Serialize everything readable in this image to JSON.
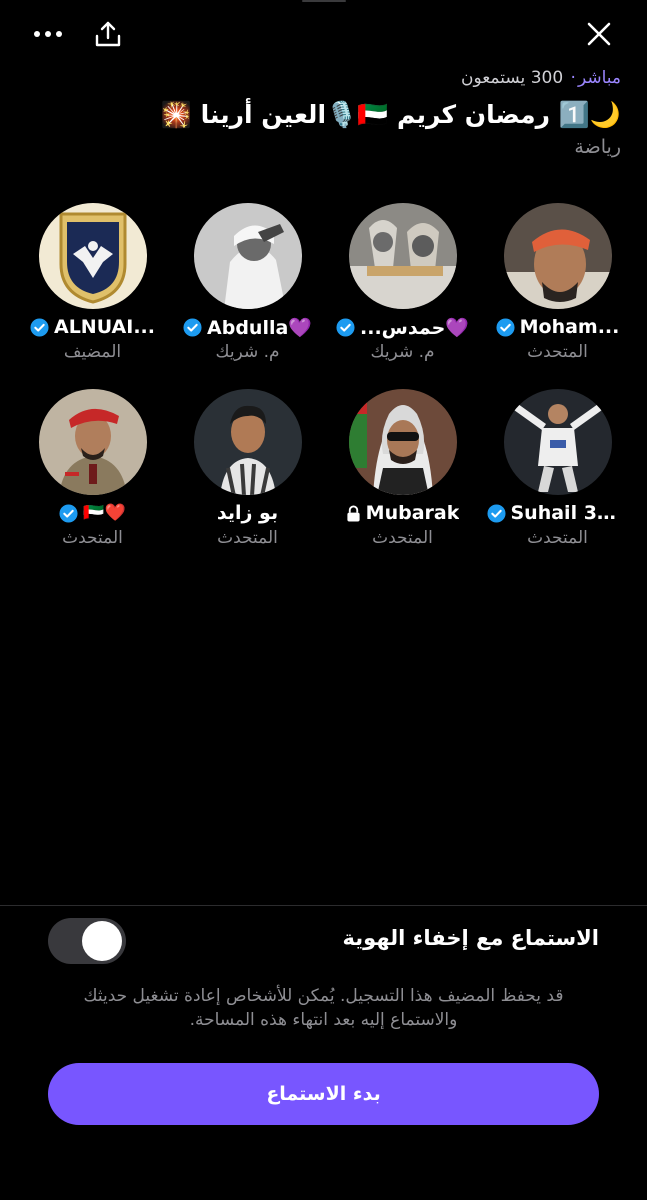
{
  "top_bar": {
    "more_icon": "more-horizontal-icon",
    "share_icon": "share-upload-icon",
    "close_icon": "close-x-icon"
  },
  "header": {
    "live_label": "مباشر",
    "separator": "·",
    "listeners": "300 يستمعون",
    "title": "🌙1️⃣ رمضان كريم 🇦🇪🎙️العين أرينا 🎇",
    "category": "رياضة"
  },
  "speakers": [
    {
      "name": "Moham...",
      "role": "المتحدث",
      "verified": true,
      "suffix": "",
      "locked": false,
      "avatar": "man-orange-cap"
    },
    {
      "name": "💜حمدس...",
      "role": "م. شريك",
      "verified": true,
      "suffix": "",
      "locked": false,
      "avatar": "trophies"
    },
    {
      "name": "Abdulla💜",
      "role": "م. شريك",
      "verified": true,
      "suffix": "",
      "locked": false,
      "avatar": "man-saluting-bw"
    },
    {
      "name": "ALNUAI...",
      "role": "المضيف",
      "verified": true,
      "suffix": "",
      "locked": false,
      "avatar": "club-crest-eagle"
    },
    {
      "name": "Suhail 38...",
      "role": "المتحدث",
      "verified": true,
      "suffix": "",
      "locked": false,
      "avatar": "footballer-celebrating"
    },
    {
      "name": "Mubarak",
      "role": "المتحدث",
      "verified": false,
      "suffix": "",
      "locked": true,
      "avatar": "man-sunglasses-ghutra"
    },
    {
      "name": "بو زايد",
      "role": "المتحدث",
      "verified": false,
      "suffix": "",
      "locked": false,
      "avatar": "footballer-portrait"
    },
    {
      "name": "",
      "role": "المتحدث",
      "verified": true,
      "suffix": "🇦🇪❤️",
      "locked": false,
      "avatar": "officer-red-beret"
    }
  ],
  "anonymous": {
    "label": "الاستماع مع إخفاء الهوية",
    "enabled": false
  },
  "note": "قد يحفظ المضيف هذا التسجيل. يُمكن للأشخاص إعادة تشغيل حديثك والاستماع إليه بعد انتهاء هذه المساحة.",
  "start_button": "بدء الاستماع",
  "colors": {
    "accent": "#7856ff",
    "live": "#9b86ff",
    "verified": "#1d9bf0",
    "muted_text": "#8e8e93"
  }
}
